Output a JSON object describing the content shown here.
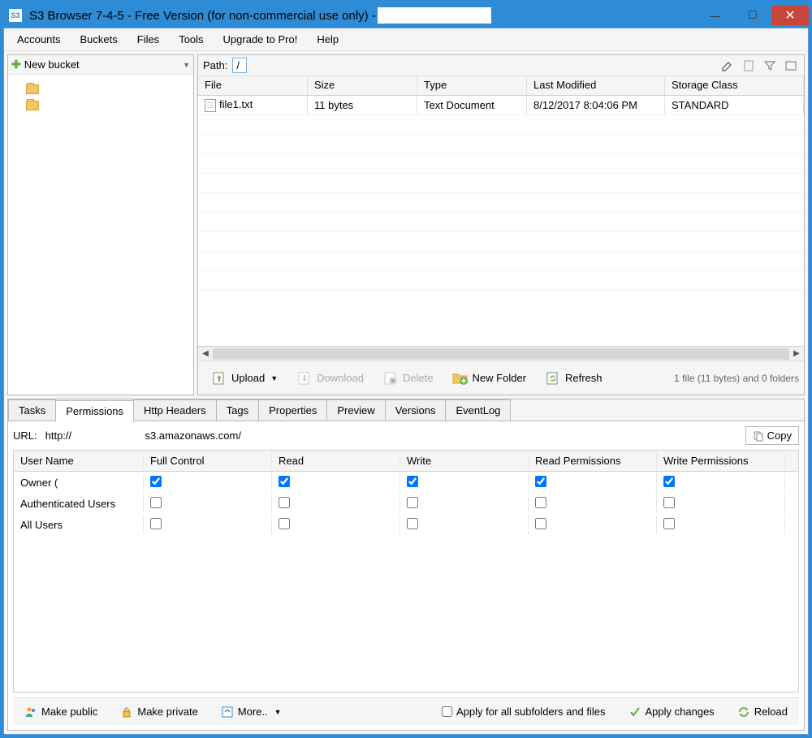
{
  "title": "S3 Browser 7-4-5 - Free Version (for non-commercial use only) -",
  "menu": [
    "Accounts",
    "Buckets",
    "Files",
    "Tools",
    "Upgrade to Pro!",
    "Help"
  ],
  "sidebar": {
    "new_bucket": "New bucket"
  },
  "path": {
    "label": "Path:",
    "value": "/"
  },
  "file_columns": [
    "File",
    "Size",
    "Type",
    "Last Modified",
    "Storage Class"
  ],
  "files": [
    {
      "name": "file1.txt",
      "size": "11 bytes",
      "type": "Text Document",
      "modified": "8/12/2017 8:04:06 PM",
      "class": "STANDARD"
    }
  ],
  "toolbar": {
    "upload": "Upload",
    "download": "Download",
    "delete": "Delete",
    "new_folder": "New Folder",
    "refresh": "Refresh"
  },
  "status": "1 file (11 bytes) and 0 folders",
  "tabs": [
    "Tasks",
    "Permissions",
    "Http Headers",
    "Tags",
    "Properties",
    "Preview",
    "Versions",
    "EventLog"
  ],
  "active_tab": 1,
  "url": {
    "label": "URL:",
    "value": "http://                         s3.amazonaws.com/",
    "copy": "Copy"
  },
  "perm_columns": [
    "User Name",
    "Full Control",
    "Read",
    "Write",
    "Read Permissions",
    "Write Permissions"
  ],
  "perm_rows": [
    {
      "user": "Owner (",
      "perms": [
        true,
        true,
        true,
        true,
        true
      ]
    },
    {
      "user": "Authenticated Users",
      "perms": [
        false,
        false,
        false,
        false,
        false
      ]
    },
    {
      "user": "All Users",
      "perms": [
        false,
        false,
        false,
        false,
        false
      ]
    }
  ],
  "bottom": {
    "make_public": "Make public",
    "make_private": "Make private",
    "more": "More..",
    "apply_all": "Apply for all subfolders and files",
    "apply_changes": "Apply changes",
    "reload": "Reload"
  }
}
